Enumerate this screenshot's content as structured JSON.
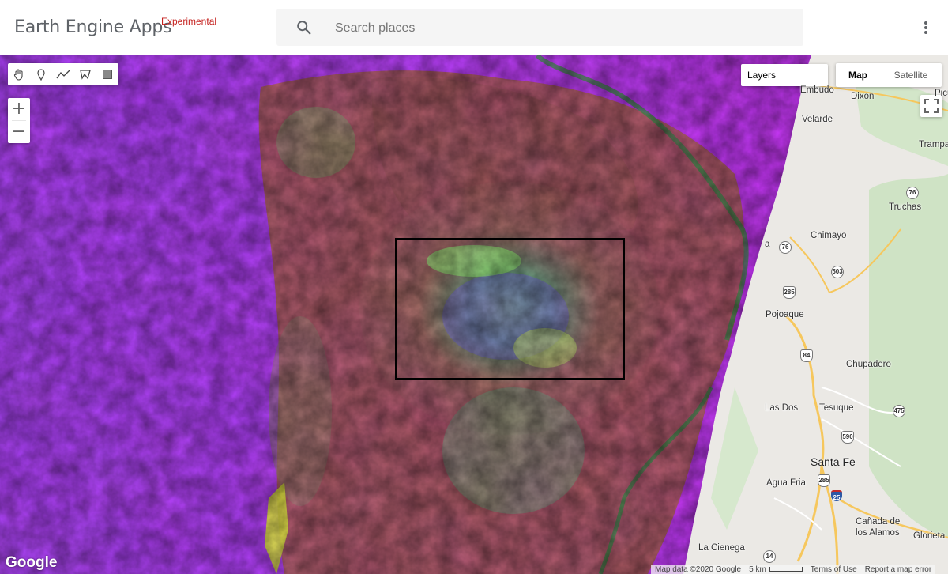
{
  "header": {
    "title": "Earth Engine Apps",
    "tag": "Experimental",
    "search_placeholder": "Search places"
  },
  "map_controls": {
    "layers_label": "Layers",
    "map_type_map": "Map",
    "map_type_satellite": "Satellite",
    "zoom_in": "+",
    "zoom_out": "−"
  },
  "drawing_tools": [
    "hand-icon",
    "marker-icon",
    "line-icon",
    "polygon-icon",
    "rectangle-icon"
  ],
  "places": {
    "embudo": "Embudo",
    "dixon": "Dixon",
    "velarde": "Velarde",
    "trampas": "Trampa",
    "picuris": "Picu",
    "truchas": "Truchas",
    "chimayo": "Chimayo",
    "pojoaque": "Pojoaque",
    "chupadero": "Chupadero",
    "las_dos": "Las Dos",
    "tesuque": "Tesuque",
    "santa_fe": "Santa Fe",
    "agua_fria": "Agua Fria",
    "canada_de_los_alamos_1": "Cañada de",
    "canada_de_los_alamos_2": "los Alamos",
    "la_cienega": "La Cienega",
    "glorieta": "Glorieta",
    "partial_a": "a"
  },
  "route_shields": {
    "r76a": "76",
    "r76b": "76",
    "r503": "503",
    "us285a": "285",
    "i84": "84",
    "r475": "475",
    "us590": "590",
    "us285b": "285",
    "i25": "25",
    "r14": "14"
  },
  "footer": {
    "google": "Google",
    "map_data": "Map data ©2020 Google",
    "scale": "5 km",
    "terms": "Terms of Use",
    "report": "Report a map error"
  },
  "colors": {
    "brand_tag": "#c5221f",
    "imagery_magenta": "#c71cf0",
    "imagery_violet": "#7b5cf0",
    "imagery_red": "#a35a4e",
    "imagery_green": "#6ad86a",
    "basemap": "#e9e7e3"
  }
}
